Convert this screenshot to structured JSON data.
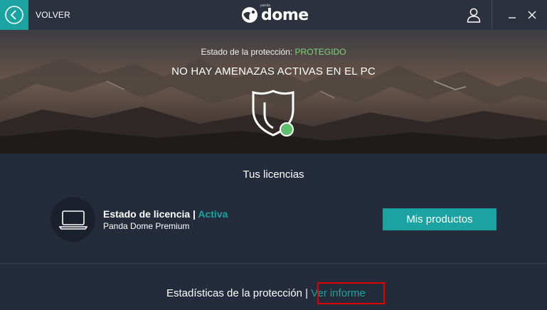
{
  "titlebar": {
    "back_label": "VOLVER",
    "logo_text": "dome",
    "logo_brand_small": "panda"
  },
  "hero": {
    "status_label": "Estado de la protección:",
    "status_value": "PROTEGIDO",
    "title": "NO HAY AMENAZAS ACTIVAS EN EL PC"
  },
  "licenses": {
    "title": "Tus licencias",
    "state_label": "Estado de licencia | ",
    "state_value": "Activa",
    "product": "Panda Dome Premium",
    "products_button": "Mis productos"
  },
  "stats": {
    "label": "Estadísticas de la protección | ",
    "report_link": "Ver informe"
  },
  "colors": {
    "accent": "#1aa3a0",
    "protected_green": "#7dd87a",
    "background": "#242c3b",
    "titlebar": "#2c323d",
    "highlight": "#e00000"
  },
  "icons": [
    "back-arrow-icon",
    "panda-logo-icon",
    "user-icon",
    "minimize-icon",
    "close-icon",
    "shield-icon",
    "status-dot-icon",
    "laptop-icon"
  ]
}
